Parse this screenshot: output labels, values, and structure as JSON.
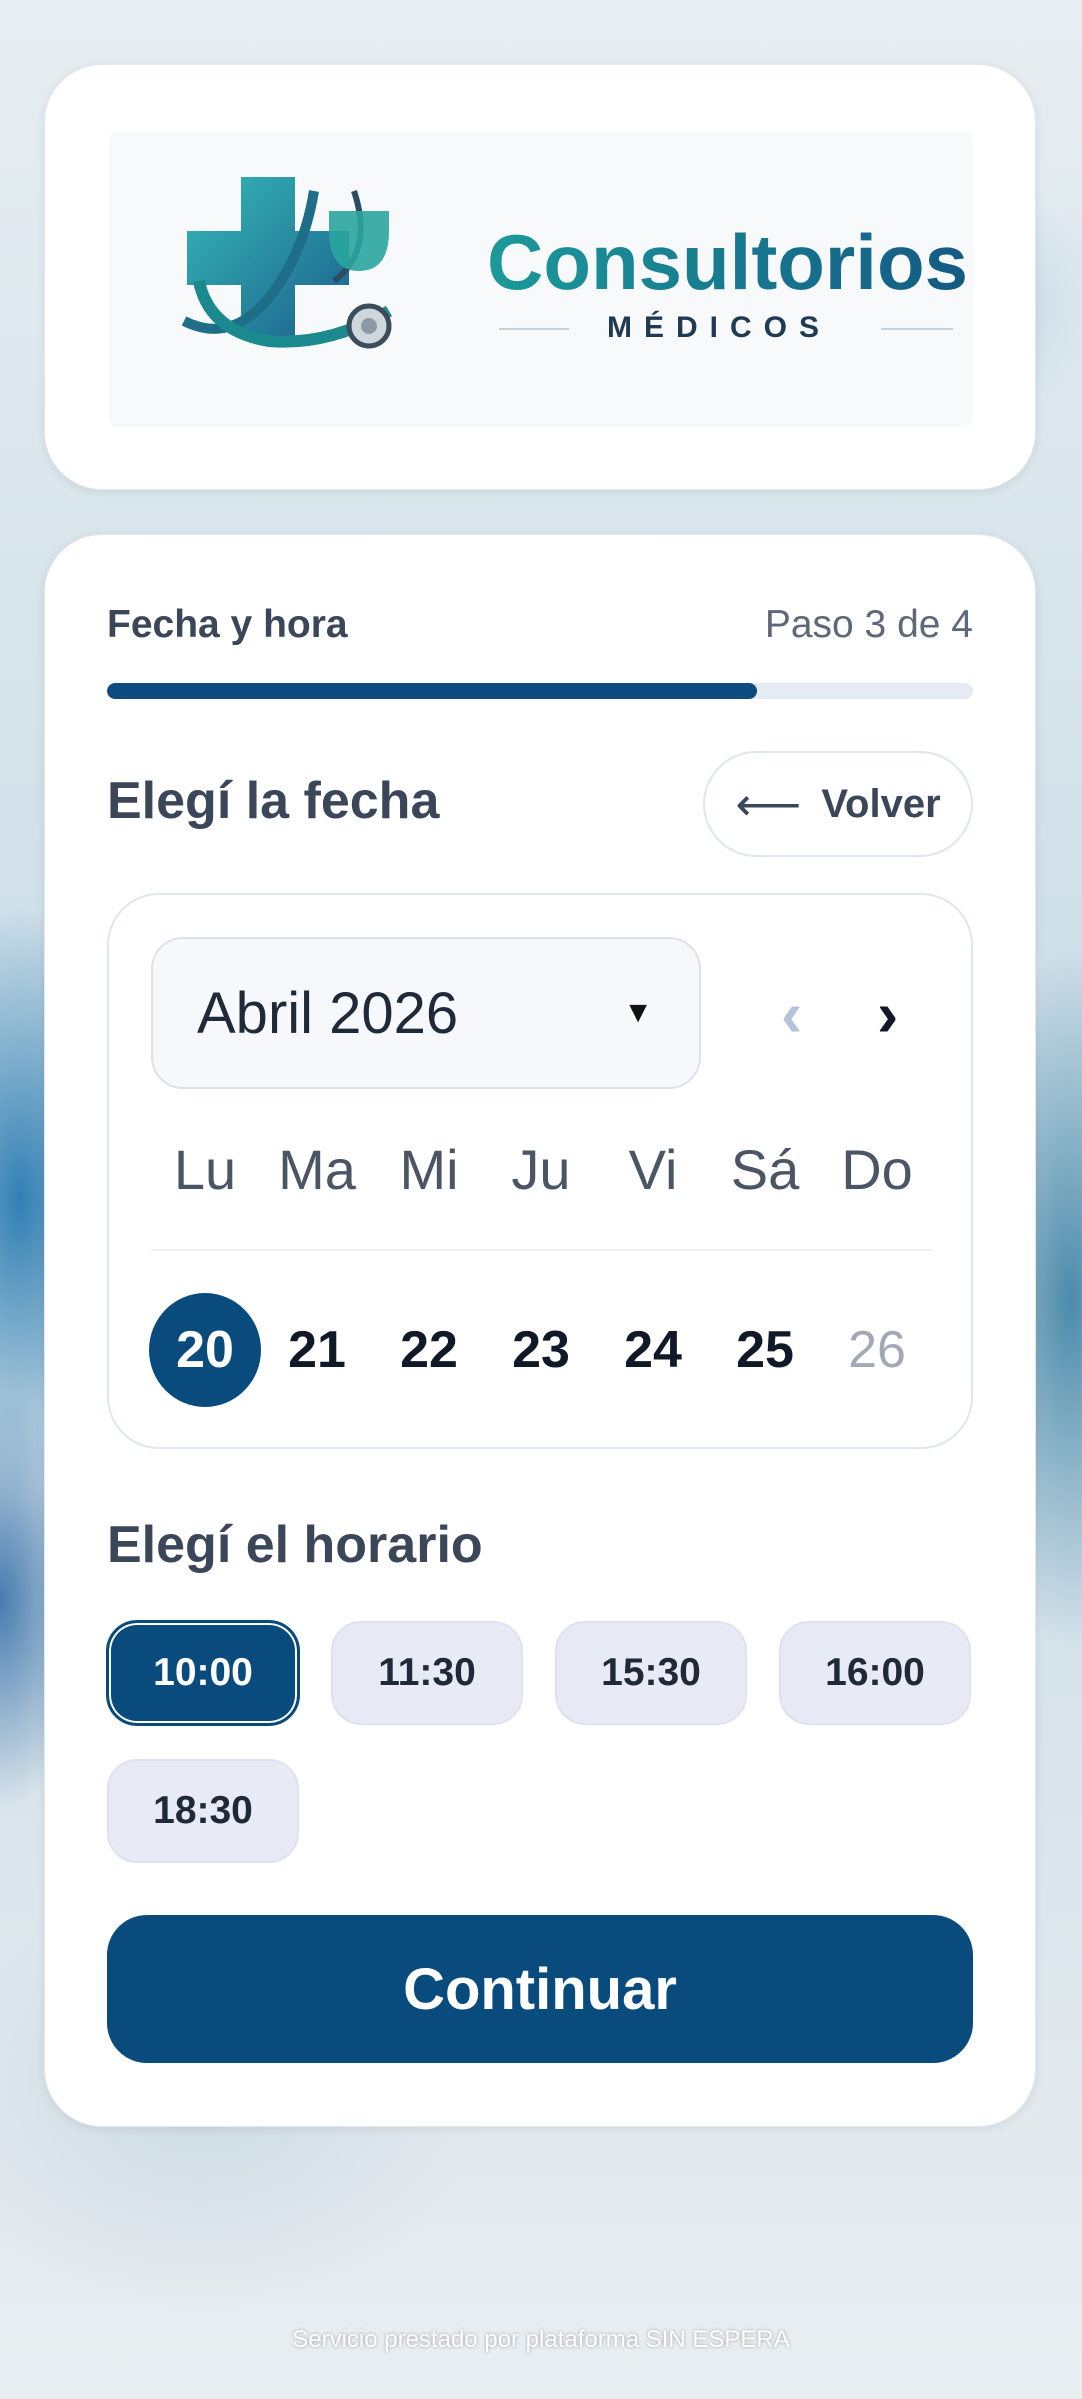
{
  "brand": {
    "name": "Consultorios",
    "subtitle": "MÉDICOS",
    "colors": {
      "teal": "#1b9a9a",
      "navy": "#145a84"
    }
  },
  "progress": {
    "title": "Fecha y hora",
    "step_label": "Paso 3 de 4",
    "fraction": 0.75
  },
  "date_section": {
    "title": "Elegí la fecha",
    "back_label": "Volver",
    "back_icon": "left-arrow-icon"
  },
  "calendar": {
    "month": "Abril 2026",
    "prev_icon": "chevron-left-icon",
    "next_icon": "chevron-right-icon",
    "weekdays": [
      "Lu",
      "Ma",
      "Mi",
      "Ju",
      "Vi",
      "Sá",
      "Do"
    ],
    "days": [
      {
        "label": "20",
        "state": "selected"
      },
      {
        "label": "21",
        "state": "available"
      },
      {
        "label": "22",
        "state": "available"
      },
      {
        "label": "23",
        "state": "available"
      },
      {
        "label": "24",
        "state": "available"
      },
      {
        "label": "25",
        "state": "available"
      },
      {
        "label": "26",
        "state": "disabled"
      }
    ]
  },
  "time_section": {
    "title": "Elegí el horario",
    "times": [
      {
        "label": "10:00",
        "selected": true
      },
      {
        "label": "11:30",
        "selected": false
      },
      {
        "label": "15:30",
        "selected": false
      },
      {
        "label": "16:00",
        "selected": false
      },
      {
        "label": "18:30",
        "selected": false
      }
    ]
  },
  "actions": {
    "continue_label": "Continuar"
  },
  "footer": {
    "text": "Servicio prestado por plataforma SIN ESPERA"
  },
  "theme": {
    "primary": "#0a4b7e",
    "chip_bg": "#e8eaf6"
  }
}
